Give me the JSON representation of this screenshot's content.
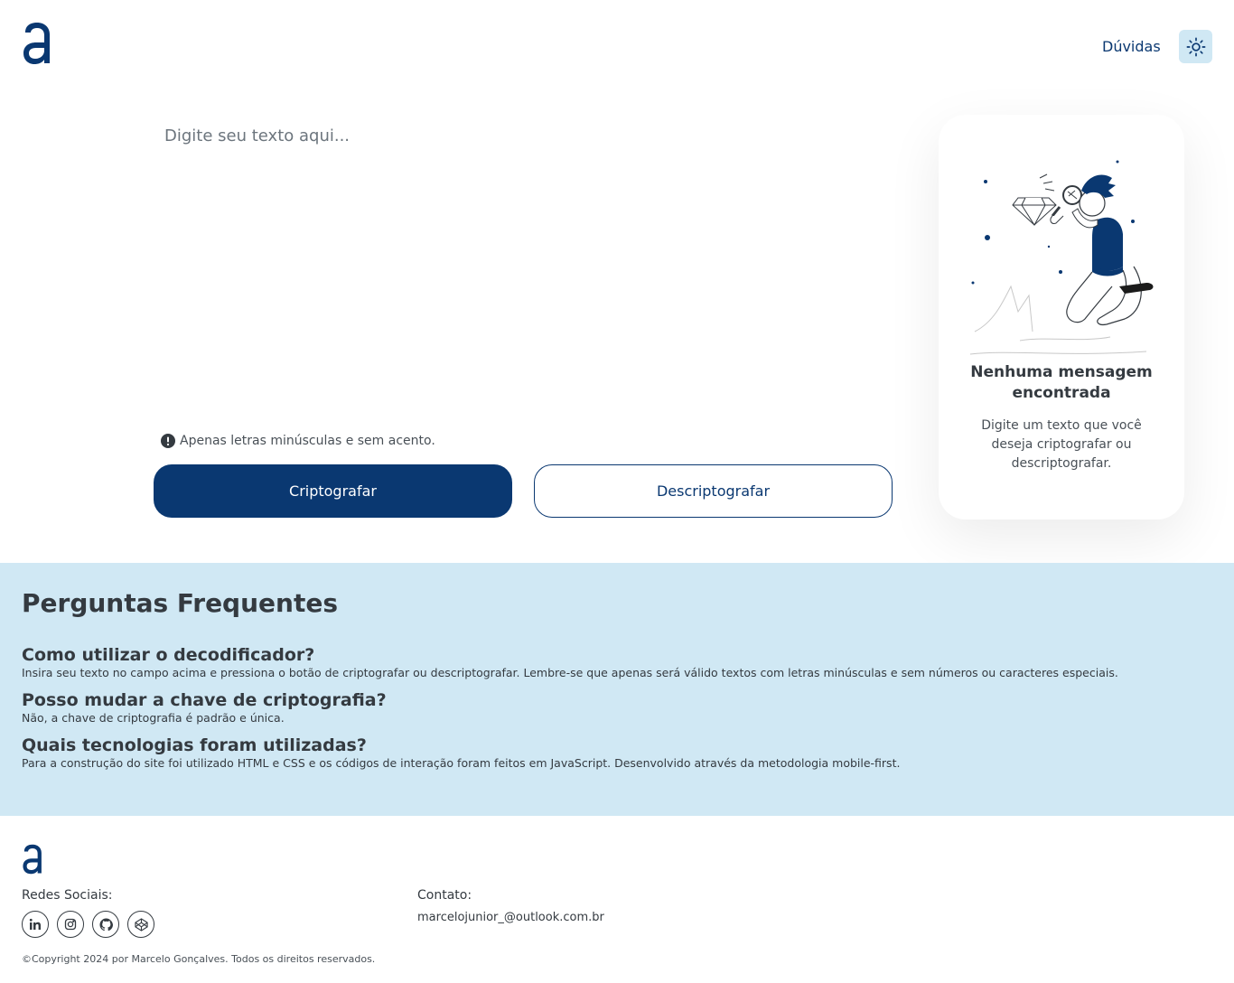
{
  "header": {
    "logo_icon": "alura-a-logo",
    "nav_link": "Dúvidas",
    "theme_toggle_icon": "sun-icon"
  },
  "input": {
    "placeholder": "Digite seu texto aqui...",
    "hint_icon": "exclamation-icon",
    "hint": "Apenas letras minúsculas e sem acento."
  },
  "buttons": {
    "encrypt_label": "Criptografar",
    "decrypt_label": "Descriptografar"
  },
  "result": {
    "illustration": "person-magnifying-glass-diamond",
    "title": "Nenhuma mensagem encontrada",
    "text": "Digite um texto que você deseja criptografar ou descriptografar."
  },
  "faq": {
    "title": "Perguntas Frequentes",
    "items": [
      {
        "question": "Como utilizar o decodificador?",
        "answer": "Insira seu texto no campo acima e pressiona o botão de criptografar ou descriptografar. Lembre-se que apenas será válido textos com letras minúsculas e sem números ou caracteres especiais."
      },
      {
        "question": "Posso mudar a chave de criptografia?",
        "answer": "Não, a chave de criptografia é padrão e única."
      },
      {
        "question": "Quais tecnologias foram utilizadas?",
        "answer": "Para a construção do site foi utilizado HTML e CSS e os códigos de interação foram feitos em JavaScript. Desenvolvido através da metodologia mobile-first."
      }
    ]
  },
  "footer": {
    "social_label": "Redes Sociais:",
    "social_icons": [
      "linkedin-icon",
      "instagram-icon",
      "github-icon",
      "codepen-icon"
    ],
    "contact_label": "Contato:",
    "contact_email": "marcelojunior_@outlook.com.br",
    "copyright": "©Copyright 2024 por Marcelo Gonçalves. Todos os direitos reservados."
  },
  "colors": {
    "primary": "#0a3871",
    "faq_bg": "#d0e8f4",
    "text_dark": "#343a40"
  }
}
